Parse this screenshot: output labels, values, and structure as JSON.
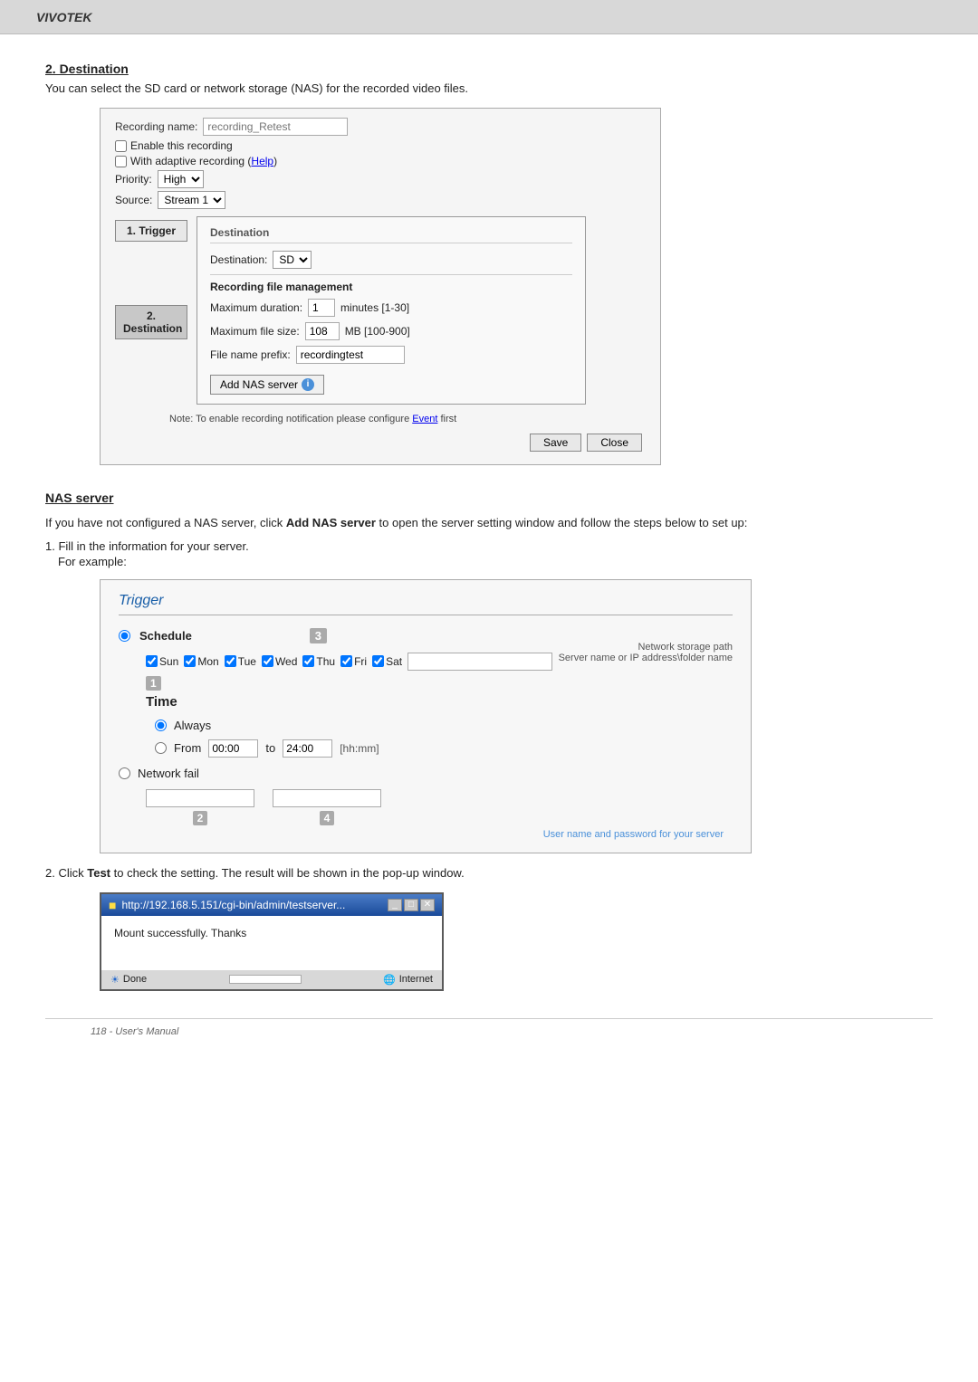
{
  "brand": "VIVOTEK",
  "section1": {
    "heading": "2. Destination",
    "description": "You can select the SD card or network storage (NAS) for the recorded video files."
  },
  "recording_dialog": {
    "name_label": "Recording name:",
    "name_placeholder": "recording_Retest",
    "enable_label": "Enable this recording",
    "adaptive_label": "With adaptive recording (Help)",
    "priority_label": "Priority:",
    "priority_value": "High",
    "source_label": "Source:",
    "source_value": "Stream 1",
    "destination_panel_title": "Destination",
    "destination_label": "Destination:",
    "destination_value": "SD",
    "rfm_title": "Recording file management",
    "max_duration_label": "Maximum duration:",
    "max_duration_value": "1",
    "max_duration_range": "minutes [1-30]",
    "max_filesize_label": "Maximum file size:",
    "max_filesize_value": "108",
    "max_filesize_range": "MB [100-900]",
    "filename_prefix_label": "File name prefix:",
    "filename_prefix_value": "recordingtest",
    "add_nas_btn": "Add NAS server",
    "note": "Note: To enable recording notification please configure Event first",
    "event_link": "Event",
    "save_btn": "Save",
    "close_btn": "Close"
  },
  "steps": {
    "step1_label": "1. Trigger",
    "step2_label": "2. Destination"
  },
  "nas_section": {
    "heading": "NAS server",
    "desc_part1": "If you have not configured a NAS server, click ",
    "desc_bold": "Add NAS server",
    "desc_part2": " to open the server setting window and follow the steps below to set up:",
    "step1_label": "1. Fill in the information for your server.",
    "step1_sub": "For example:"
  },
  "trigger_panel": {
    "title": "Trigger",
    "schedule_label": "Schedule",
    "callout_3": "3",
    "nas_path_annotation": "Network storage path",
    "nas_path_hint": "Server name or IP address\\folder name",
    "days": [
      "Sun",
      "Mon",
      "Tue",
      "Wed",
      "Thu",
      "Fri",
      "Sat"
    ],
    "days_checked": [
      true,
      true,
      true,
      true,
      true,
      true,
      true
    ],
    "callout_1": "1",
    "time_label": "Time",
    "always_label": "Always",
    "from_label": "From",
    "from_value": "00:00",
    "to_label": "to",
    "to_value": "24:00",
    "hhmm_hint": "[hh:mm]",
    "network_fail_label": "Network fail",
    "callout_2": "2",
    "callout_4": "4",
    "userpass_annotation": "User name and password for your server"
  },
  "step2": {
    "label": "2. Click ",
    "test_bold": "Test",
    "label2": " to check the setting. The result will be shown in the pop-up window."
  },
  "popup": {
    "title_url": "http://192.168.5.151/cgi-bin/admin/testserver...",
    "content": "Mount successfully. Thanks",
    "done_label": "Done",
    "internet_label": "Internet"
  },
  "footer": {
    "text": "118 - User's Manual"
  }
}
